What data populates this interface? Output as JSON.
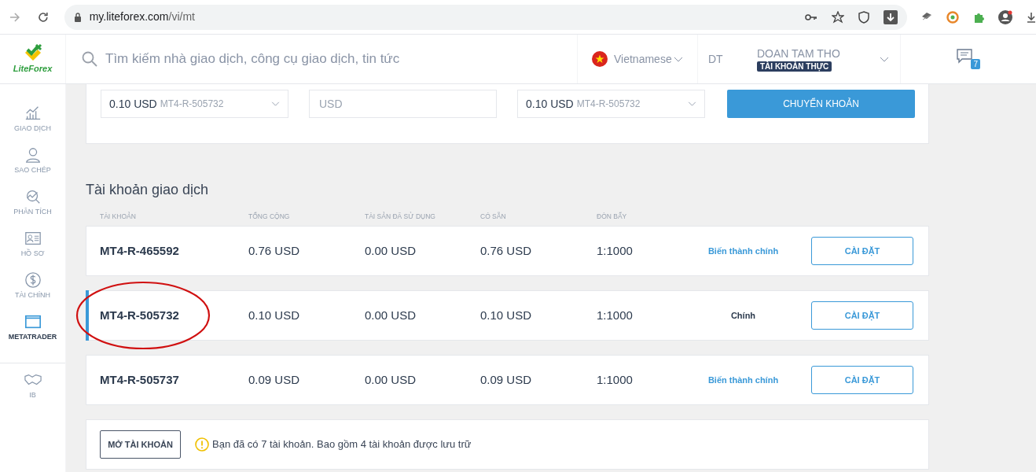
{
  "browser": {
    "url_host": "my.liteforex.com",
    "url_path": "/vi/mt"
  },
  "header": {
    "logo": "LiteForex",
    "search_placeholder": "Tìm kiếm nhà giao dịch, công cụ giao dịch, tin tức",
    "language": "Vietnamese",
    "user_initials": "DT",
    "user_name": "DOAN TAM THO",
    "account_type": "TÀI KHOẢN THỰC",
    "messages_count": "7"
  },
  "sidebar": {
    "items": [
      {
        "label": "GIAO DỊCH",
        "selected": false
      },
      {
        "label": "SAO CHÉP",
        "selected": false
      },
      {
        "label": "PHÂN TÍCH",
        "selected": false
      },
      {
        "label": "HỒ SƠ",
        "selected": false
      },
      {
        "label": "TÀI CHÍNH",
        "selected": false
      },
      {
        "label": "METATRADER",
        "selected": true
      },
      {
        "label": "IB",
        "selected": false
      }
    ]
  },
  "transfer": {
    "from_amount": "0.10 USD",
    "from_account": "MT4-R-505732",
    "amount_placeholder": "USD",
    "to_amount": "0.10 USD",
    "to_account": "MT4-R-505732",
    "button": "CHUYỂN KHOẢN"
  },
  "accounts": {
    "title": "Tài khoản giao dịch",
    "columns": [
      "TÀI KHOẢN",
      "TỔNG CỘNG",
      "TÀI SẢN ĐÃ SỬ DỤNG",
      "CÓ SẴN",
      "ĐÒN BẨY"
    ],
    "rows": [
      {
        "account": "MT4-R-465592",
        "total": "0.76 USD",
        "used": "0.00 USD",
        "available": "0.76 USD",
        "leverage": "1:1000",
        "status": "Biến thành chính",
        "is_main": false,
        "selected": false,
        "button": "CÀI ĐẶT"
      },
      {
        "account": "MT4-R-505732",
        "total": "0.10 USD",
        "used": "0.00 USD",
        "available": "0.10 USD",
        "leverage": "1:1000",
        "status": "Chính",
        "is_main": true,
        "selected": true,
        "button": "CÀI ĐẶT"
      },
      {
        "account": "MT4-R-505737",
        "total": "0.09 USD",
        "used": "0.00 USD",
        "available": "0.09 USD",
        "leverage": "1:1000",
        "status": "Biến thành chính",
        "is_main": false,
        "selected": false,
        "button": "CÀI ĐẶT"
      }
    ]
  },
  "footer": {
    "button": "MỞ TÀI KHOẢN",
    "notice": "Bạn đã có 7 tài khoản. Bao gồm 4 tài khoản được lưu trữ"
  }
}
